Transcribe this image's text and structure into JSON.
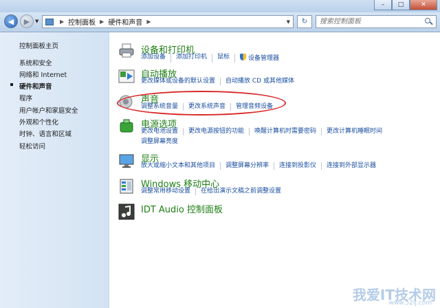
{
  "window": {
    "min_label": "–",
    "max_label": "□",
    "close_label": "✕"
  },
  "nav": {
    "breadcrumb": [
      "控制面板",
      "硬件和声音"
    ],
    "search_placeholder": "搜索控制面板"
  },
  "sidebar": {
    "items": [
      {
        "label": "控制面板主页"
      },
      {
        "label": "系统和安全"
      },
      {
        "label": "网络和 Internet"
      },
      {
        "label": "硬件和声音"
      },
      {
        "label": "程序"
      },
      {
        "label": "用户帐户和家庭安全"
      },
      {
        "label": "外观和个性化"
      },
      {
        "label": "时钟、语言和区域"
      },
      {
        "label": "轻松访问"
      }
    ],
    "current_index": 3
  },
  "categories": [
    {
      "icon": "printer-icon",
      "title": "设备和打印机",
      "links": [
        "添加设备",
        "添加打印机",
        "鼠标",
        "设备管理器"
      ]
    },
    {
      "icon": "autoplay-icon",
      "title": "自动播放",
      "links": [
        "更改媒体或设备的默认设置",
        "自动播放 CD 或其他媒体"
      ]
    },
    {
      "icon": "speaker-icon",
      "title": "声音",
      "links": [
        "调整系统音量",
        "更改系统声音",
        "管理音频设备"
      ]
    },
    {
      "icon": "power-icon",
      "title": "电源选项",
      "links": [
        "更改电池设置",
        "更改电源按钮的功能",
        "唤醒计算机时需要密码",
        "更改计算机睡眠时间"
      ],
      "links2": [
        "调整屏幕亮度"
      ]
    },
    {
      "icon": "display-icon",
      "title": "显示",
      "links": [
        "放大或缩小文本和其他项目",
        "调整屏幕分辨率",
        "连接到投影仪",
        "连接到外部显示器"
      ]
    },
    {
      "icon": "mobility-center-icon",
      "title": "Windows 移动中心",
      "links": [
        "调整常用移动设置",
        "在给出演示文稿之前调整设置"
      ]
    },
    {
      "icon": "idt-audio-icon",
      "title": "IDT Audio 控制面板",
      "links": []
    }
  ],
  "watermark": {
    "text": "我爱IT技术网",
    "url": "www.52ij.com"
  },
  "colors": {
    "category_title": "#1e7e14",
    "link": "#1a4ea0",
    "highlight_oval": "#d82a2a"
  }
}
